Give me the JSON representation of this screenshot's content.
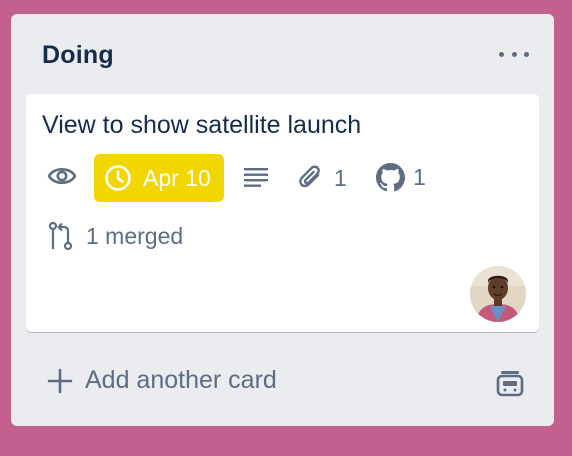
{
  "list": {
    "title": "Doing",
    "add_card_label": "Add another card"
  },
  "card": {
    "title": "View to show satellite launch",
    "due_date": "Apr 10",
    "attachments_count": "1",
    "github_count": "1",
    "pull_requests": "1 merged"
  },
  "colors": {
    "board_background": "#c4608d",
    "list_background": "#ebecf0",
    "due_badge": "#f2d600",
    "text_primary": "#172b4d",
    "text_secondary": "#5e6c84"
  },
  "icons": [
    "more-icon",
    "eye-icon",
    "clock-icon",
    "description-icon",
    "paperclip-icon",
    "github-icon",
    "pull-request-icon",
    "plus-icon",
    "card-template-icon"
  ]
}
